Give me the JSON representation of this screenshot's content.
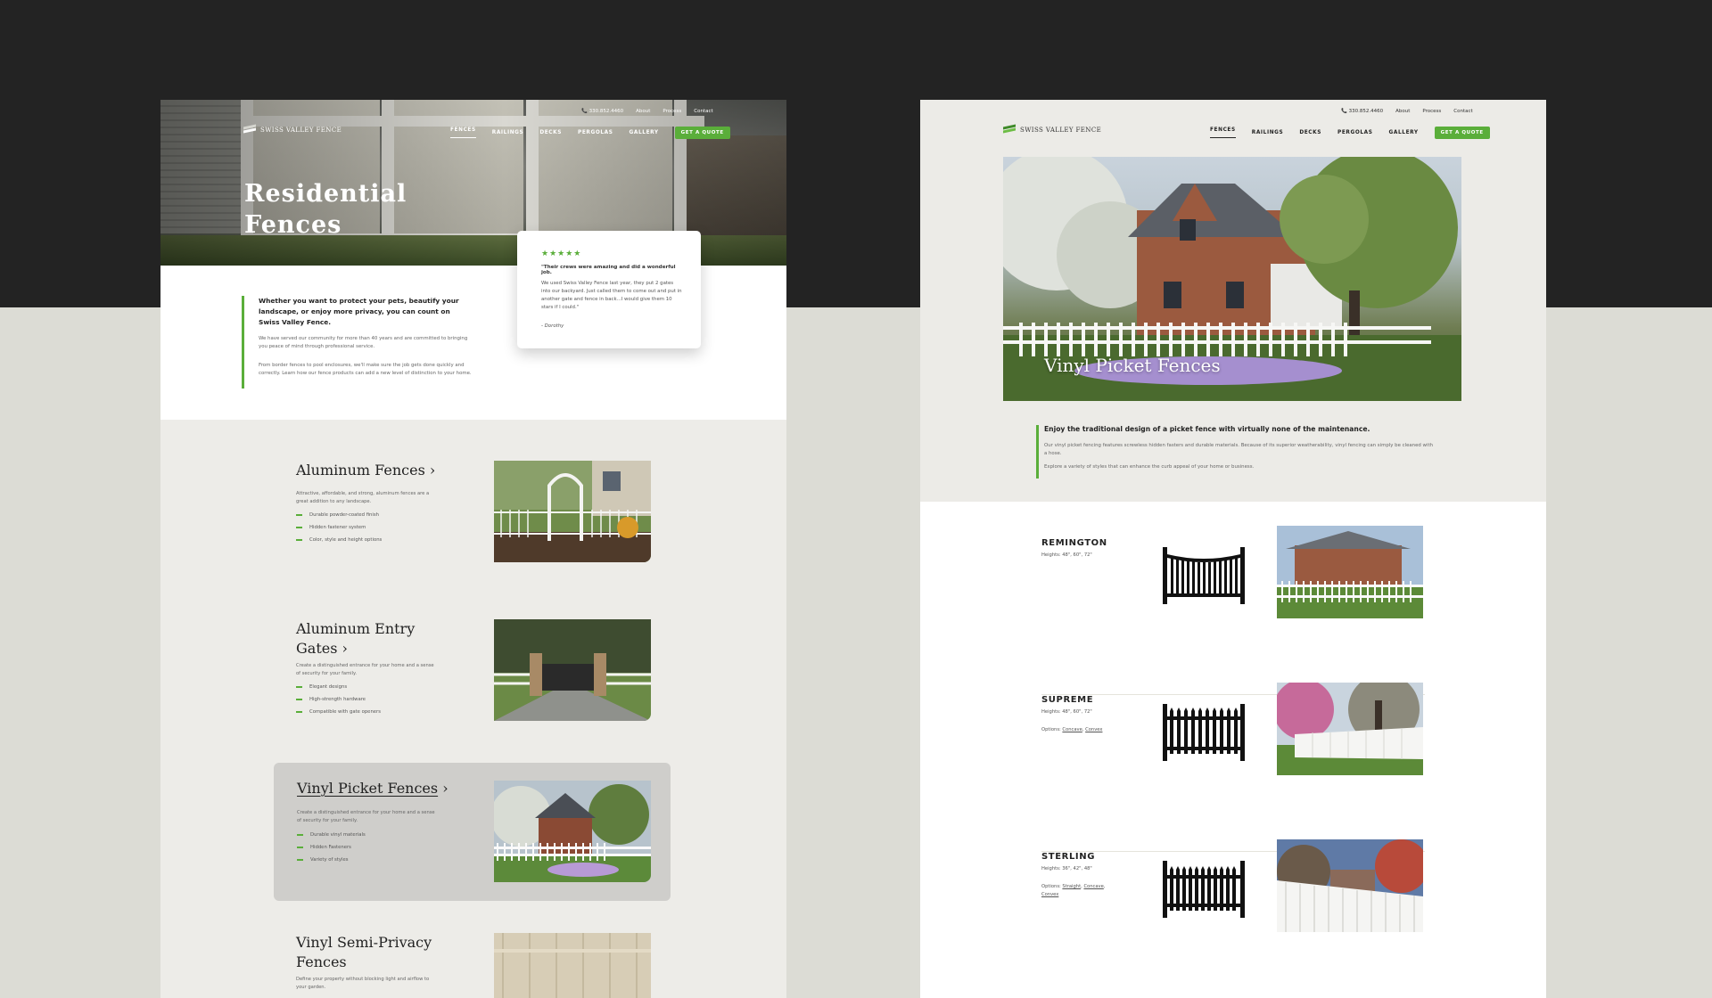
{
  "brand": {
    "name": "SWISS VALLEY FENCE",
    "accent": "#5aae3a"
  },
  "utility": {
    "phone": "330.852.4460",
    "links": [
      "About",
      "Process",
      "Contact"
    ]
  },
  "nav": {
    "items": [
      "FENCES",
      "RAILINGS",
      "DECKS",
      "PERGOLAS",
      "GALLERY"
    ],
    "active": "FENCES",
    "cta": "GET A QUOTE"
  },
  "left": {
    "hero_title_line1": "Residential",
    "hero_title_line2": "Fences",
    "intro_heading": "Whether you want to protect your pets, beautify your landscape, or enjoy more privacy, you can count on Swiss Valley Fence.",
    "intro_p1": "We have served our community for more than 40 years and are committed to bringing you peace of mind through professional service.",
    "intro_p2": "From border fences to pool enclosures, we'll make sure the job gets done quickly and correctly. Learn how our fence products can add a new level of distinction to your home.",
    "review": {
      "stars": "★★★★★",
      "quote": "\"Their crews were amazing and did a wonderful job.",
      "body": "We used Swiss Valley Fence last year, they put 2 gates into our backyard. Just called them to come out and put in another gate and fence in back...I would give them 10 stars if I could.\"",
      "author": "- Dorothy"
    },
    "products": [
      {
        "title": "Aluminum Fences",
        "desc": "Attractive, affordable, and strong, aluminum fences are a great addition to any landscape.",
        "bullets": [
          "Durable powder-coated finish",
          "Hidden fastener system",
          "Color, style and height options"
        ]
      },
      {
        "title_line1": "Aluminum Entry",
        "title_line2": "Gates",
        "desc": "Create a distinguished entrance for your home and a sense of security for your family.",
        "bullets": [
          "Elegant designs",
          "High-strength hardware",
          "Compatible with gate openers"
        ]
      },
      {
        "title": "Vinyl Picket Fences",
        "desc": "Create a distinguished entrance for your home and a sense of security for your family.",
        "bullets": [
          "Durable vinyl materials",
          "Hidden Fasteners",
          "Variety of styles"
        ]
      },
      {
        "title_line1": "Vinyl Semi-Privacy",
        "title_line2": "Fences",
        "desc": "Define your property without blocking light and airflow to your garden."
      }
    ]
  },
  "right": {
    "hero_title": "Vinyl Picket Fences",
    "lead_heading": "Enjoy the traditional design of a picket fence with virtually none of the maintenance.",
    "lead_p1": "Our vinyl picket fencing features screwless hidden fasters and durable materials. Because of its superior weatherability, vinyl fencing can simply be cleaned with a hose.",
    "lead_p2": "Explore a variety of styles that can enhance the curb appeal of your home or business.",
    "styles": [
      {
        "name": "REMINGTON",
        "heights": "Heights: 48\", 60\", 72\""
      },
      {
        "name": "SUPREME",
        "heights": "Heights: 48\", 60\", 72\"",
        "options_label": "Options:",
        "options": [
          "Concave",
          "Convex"
        ]
      },
      {
        "name": "STERLING",
        "heights": "Heights: 36\", 42\", 48\"",
        "options_label": "Options:",
        "options": [
          "Straight",
          "Concave",
          "Convex"
        ]
      }
    ]
  }
}
